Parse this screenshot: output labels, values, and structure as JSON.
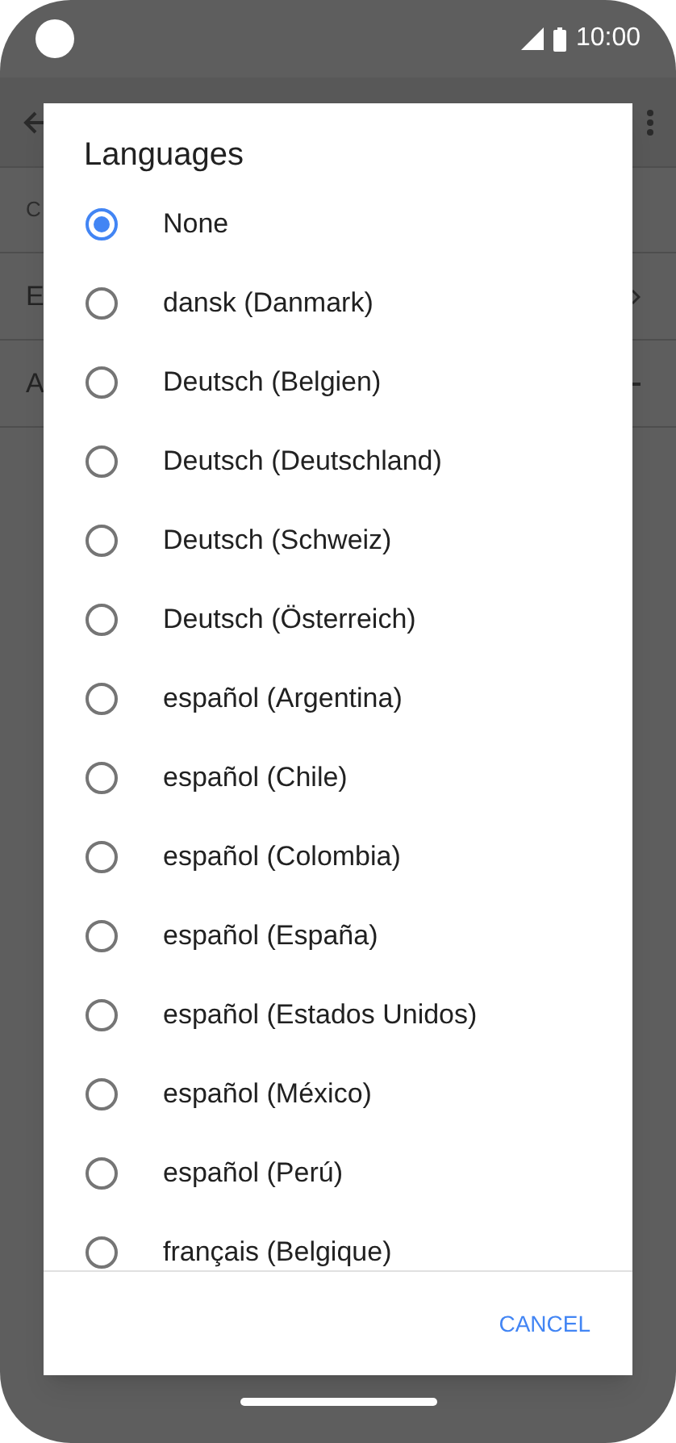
{
  "status_bar": {
    "time": "10:00"
  },
  "background_rows": [
    {
      "text": "C",
      "kind": "header"
    },
    {
      "text": "E",
      "kind": "chevron"
    },
    {
      "text": "A",
      "kind": "dash"
    }
  ],
  "dialog": {
    "title": "Languages",
    "options": [
      {
        "label": "None",
        "selected": true
      },
      {
        "label": "dansk (Danmark)",
        "selected": false
      },
      {
        "label": "Deutsch (Belgien)",
        "selected": false
      },
      {
        "label": "Deutsch (Deutschland)",
        "selected": false
      },
      {
        "label": "Deutsch (Schweiz)",
        "selected": false
      },
      {
        "label": "Deutsch (Österreich)",
        "selected": false
      },
      {
        "label": "español (Argentina)",
        "selected": false
      },
      {
        "label": "español (Chile)",
        "selected": false
      },
      {
        "label": "español (Colombia)",
        "selected": false
      },
      {
        "label": "español (España)",
        "selected": false
      },
      {
        "label": "español (Estados Unidos)",
        "selected": false
      },
      {
        "label": "español (México)",
        "selected": false
      },
      {
        "label": "español (Perú)",
        "selected": false
      },
      {
        "label": "français (Belgique)",
        "selected": false
      }
    ],
    "buttons": [
      "CANCEL"
    ]
  }
}
